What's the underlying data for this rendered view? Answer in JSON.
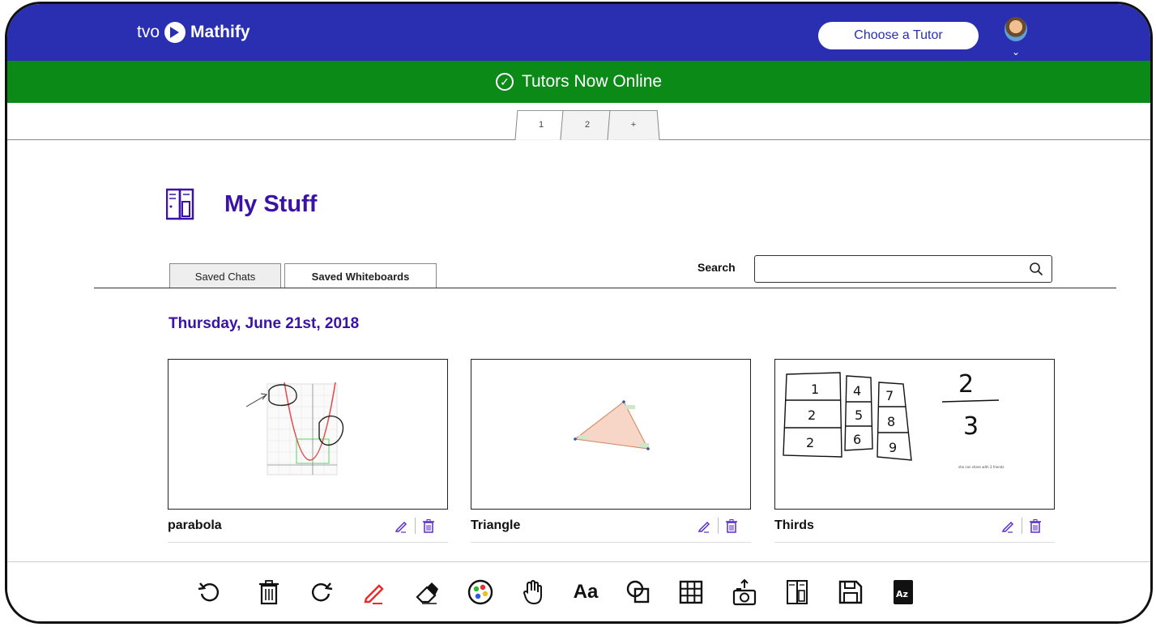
{
  "header": {
    "logo_tvo": "tvo",
    "logo_name": "Mathify",
    "tutor_button": "Choose a Tutor",
    "brand_color": "#2a2fb2"
  },
  "status_bar": {
    "text": "Tutors Now Online",
    "color": "#0c8a18"
  },
  "page_tabs": [
    "1",
    "2",
    "+"
  ],
  "main": {
    "title": "My Stuff",
    "subtabs": [
      "Saved Chats",
      "Saved Whiteboards"
    ],
    "active_subtab": "Saved Whiteboards",
    "search_label": "Search",
    "search_value": "",
    "date_heading": "Thursday, June 21st, 2018",
    "cards": [
      {
        "name": "parabola"
      },
      {
        "name": "Triangle"
      },
      {
        "name": "Thirds"
      }
    ],
    "thirds_caption": "she can share with 3 friends",
    "accent_color": "#3b12a8"
  },
  "toolbar": {
    "icons": [
      "undo-icon",
      "trash-icon",
      "redo-icon",
      "pen-icon",
      "eraser-icon",
      "color-palette-icon",
      "hand-icon",
      "text-icon",
      "shapes-icon",
      "grid-icon",
      "camera-icon",
      "my-stuff-icon",
      "save-icon",
      "dictionary-icon"
    ],
    "text_label": "Aa"
  }
}
